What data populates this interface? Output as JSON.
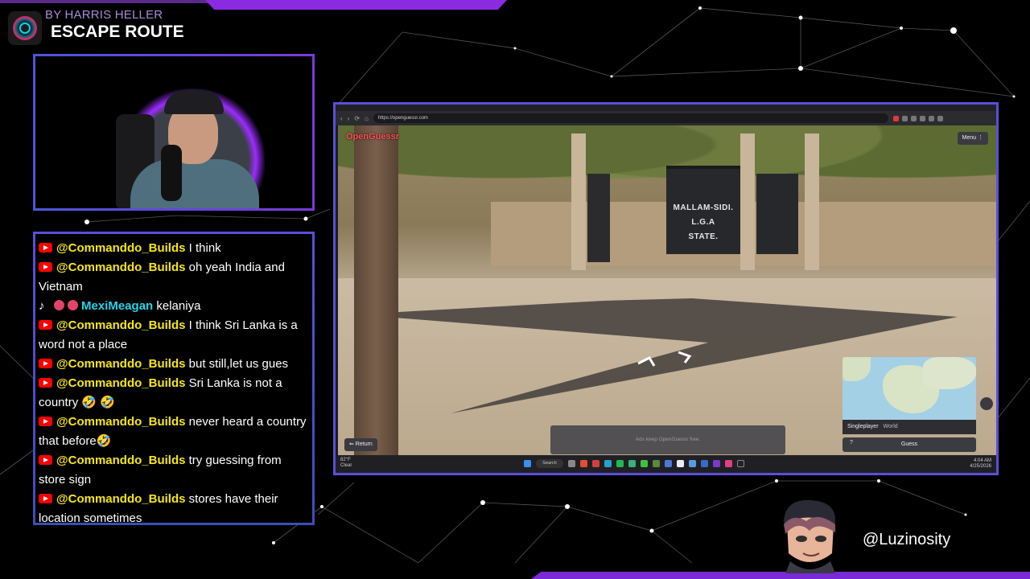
{
  "now_playing": {
    "artist": "BY HARRIS HELLER",
    "title": "ESCAPE ROUTE"
  },
  "chat": {
    "messages": [
      {
        "platform": "youtube",
        "user": "@Commanddo_Builds",
        "text": "I think"
      },
      {
        "platform": "youtube",
        "user": "@Commanddo_Builds",
        "text": "oh yeah India and Vietnam"
      },
      {
        "platform": "tiktok",
        "user": "MexiMeagan",
        "text": "kelaniya"
      },
      {
        "platform": "youtube",
        "user": "@Commanddo_Builds",
        "text": "I think Sri Lanka is a word not a place"
      },
      {
        "platform": "youtube",
        "user": "@Commanddo_Builds",
        "text": "but still,let us gues"
      },
      {
        "platform": "youtube",
        "user": "@Commanddo_Builds",
        "text": "Sri Lanka is not a country 🤣 🤣"
      },
      {
        "platform": "youtube",
        "user": "@Commanddo_Builds",
        "text": "never heard a country that before🤣"
      },
      {
        "platform": "youtube",
        "user": "@Commanddo_Builds",
        "text": "try guessing from store sign"
      },
      {
        "platform": "youtube",
        "user": "@Commanddo_Builds",
        "text": "stores have their location sometimes"
      }
    ]
  },
  "browser": {
    "url": "https://openguessr.com"
  },
  "game": {
    "logo": "OpenGuessr",
    "menu_label": "Menu ⋮",
    "return_label": "⇐ Return",
    "ads_text": "Ads keep OpenGuessr free.",
    "sign_lines": [
      "MALLAM-SIDI.",
      "L.G.A",
      "STATE."
    ],
    "mode": "Singleplayer",
    "region": "World",
    "guess_label": "Guess",
    "help_label": "?"
  },
  "taskbar": {
    "temperature": "82°F",
    "condition": "Clear",
    "search_label": "Search",
    "time": "4:04 AM",
    "date": "4/25/2026"
  },
  "streamer_handle": "@Luzinosity",
  "colors": {
    "accent": "#8a2be2",
    "frame": "#5a4fd8",
    "yt_user": "#f5e61a",
    "tt_user": "#22d4e8"
  }
}
